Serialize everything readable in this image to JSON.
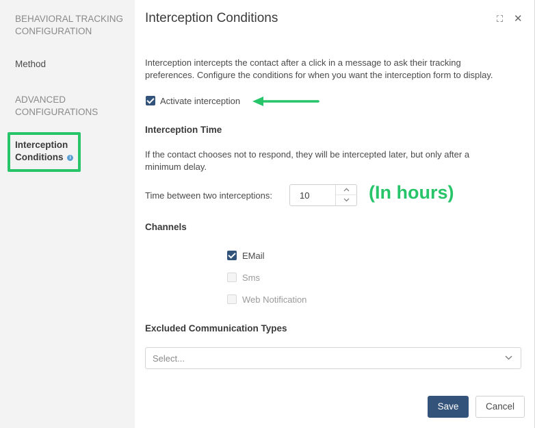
{
  "sidebar": {
    "section1": "BEHAVIORAL TRACKING CONFIGURATION",
    "method": "Method",
    "section2": "ADVANCED CONFIGURATIONS",
    "active_line1": "Interception",
    "active_line2": "Conditions",
    "info_glyph": "i"
  },
  "dialog": {
    "title": "Interception Conditions",
    "expand_glyph": "⛶",
    "close_glyph": "✕"
  },
  "intro": {
    "line1": "Interception intercepts the contact after a click in a message to ask their tracking",
    "line2": "preferences. Configure the conditions for when you want the interception form to display."
  },
  "activate": {
    "label": "Activate interception",
    "checked": true
  },
  "interception_time": {
    "heading": "Interception Time",
    "desc_line1": "If the contact chooses not to respond, they will be intercepted later, but only after a",
    "desc_line2": "minimum delay.",
    "field_label": "Time between two interceptions:",
    "value": "10",
    "annotation": "(In hours)"
  },
  "channels": {
    "heading": "Channels",
    "items": [
      {
        "label": "EMail",
        "checked": true
      },
      {
        "label": "Sms",
        "checked": false
      },
      {
        "label": "Web Notification",
        "checked": false
      }
    ]
  },
  "excluded": {
    "heading": "Excluded Communication Types",
    "placeholder": "Select..."
  },
  "footer": {
    "save_label": "Save",
    "cancel_label": "Cancel"
  },
  "colors": {
    "accent": "#33537a",
    "highlight": "#27c46a",
    "sidebar_bg": "#f3f3f3"
  }
}
